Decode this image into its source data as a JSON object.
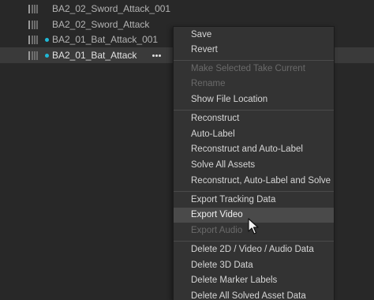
{
  "takes": [
    {
      "name": "BA2_02_Sword_Attack_001",
      "has_dot": false,
      "selected": false
    },
    {
      "name": "BA2_02_Sword_Attack",
      "has_dot": false,
      "selected": false
    },
    {
      "name": "BA2_01_Bat_Attack_001",
      "has_dot": true,
      "selected": false
    },
    {
      "name": "BA2_01_Bat_Attack",
      "has_dot": true,
      "selected": true
    }
  ],
  "more_button_icon": "more-horizontal-icon",
  "context_menu": {
    "groups": [
      [
        {
          "label": "Save",
          "enabled": true
        },
        {
          "label": "Revert",
          "enabled": true
        }
      ],
      [
        {
          "label": "Make Selected Take Current",
          "enabled": false
        },
        {
          "label": "Rename",
          "enabled": false
        },
        {
          "label": "Show File Location",
          "enabled": true
        }
      ],
      [
        {
          "label": "Reconstruct",
          "enabled": true
        },
        {
          "label": "Auto-Label",
          "enabled": true
        },
        {
          "label": "Reconstruct and Auto-Label",
          "enabled": true
        },
        {
          "label": "Solve All Assets",
          "enabled": true
        },
        {
          "label": "Reconstruct, Auto-Label and Solve",
          "enabled": true
        }
      ],
      [
        {
          "label": "Export Tracking Data",
          "enabled": true
        },
        {
          "label": "Export Video",
          "enabled": true,
          "hovered": true
        },
        {
          "label": "Export Audio",
          "enabled": false
        }
      ],
      [
        {
          "label": "Delete 2D / Video / Audio Data",
          "enabled": true
        },
        {
          "label": "Delete 3D Data",
          "enabled": true
        },
        {
          "label": "Delete Marker Labels",
          "enabled": true
        },
        {
          "label": "Delete All Solved Asset Data",
          "enabled": true
        }
      ]
    ]
  },
  "colors": {
    "background": "#282828",
    "selected_row": "#3a3a3a",
    "dot_accent": "#1fb8d6",
    "menu_background": "#333333",
    "menu_hover": "#4a4a4a"
  },
  "cursor_icon": "arrow-cursor-icon"
}
